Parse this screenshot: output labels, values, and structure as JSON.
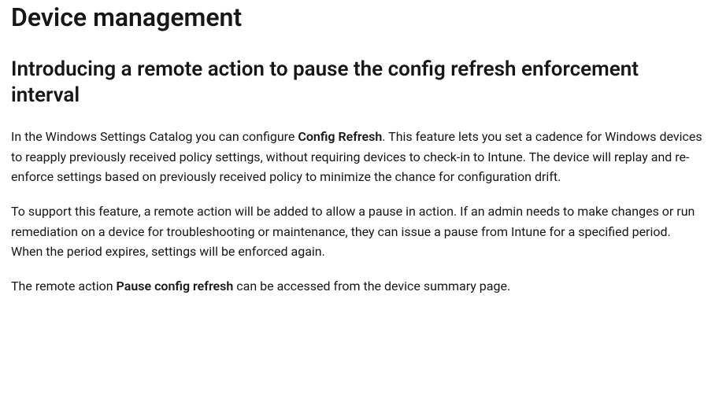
{
  "heading": "Device management",
  "subheading": "Introducing a remote action to pause the config refresh enforcement interval",
  "para1_part1": "In the Windows Settings Catalog you can configure ",
  "para1_bold": "Config Refresh",
  "para1_part2": ". This feature lets you set a cadence for Windows devices to reapply previously received policy settings, without requiring devices to check-in to Intune. The device will replay and re-enforce settings based on previously received policy to minimize the chance for configuration drift.",
  "para2": "To support this feature, a remote action will be added to allow a pause in action. If an admin needs to make changes or run remediation on a device for troubleshooting or maintenance, they can issue a pause from Intune for a specified period. When the period expires, settings will be enforced again.",
  "para3_part1": "The remote action ",
  "para3_bold": "Pause config refresh",
  "para3_part2": " can be accessed from the device summary page."
}
